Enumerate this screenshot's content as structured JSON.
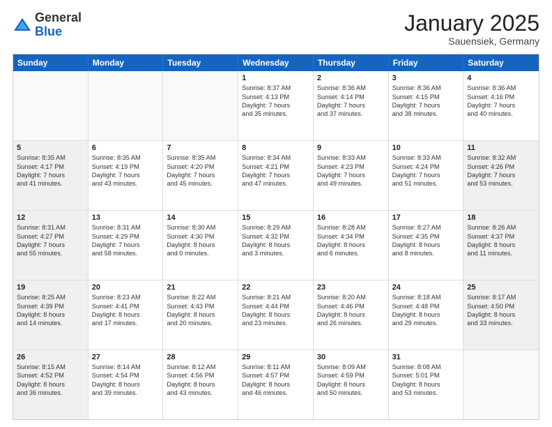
{
  "logo": {
    "general": "General",
    "blue": "Blue"
  },
  "header": {
    "month": "January 2025",
    "location": "Sauensiek, Germany"
  },
  "weekdays": [
    "Sunday",
    "Monday",
    "Tuesday",
    "Wednesday",
    "Thursday",
    "Friday",
    "Saturday"
  ],
  "rows": [
    [
      {
        "day": "",
        "sunrise": "",
        "sunset": "",
        "daylight": "",
        "shaded": true
      },
      {
        "day": "",
        "sunrise": "",
        "sunset": "",
        "daylight": "",
        "shaded": true
      },
      {
        "day": "",
        "sunrise": "",
        "sunset": "",
        "daylight": "",
        "shaded": true
      },
      {
        "day": "1",
        "sunrise": "Sunrise: 8:37 AM",
        "sunset": "Sunset: 4:13 PM",
        "daylight": "Daylight: 7 hours and 35 minutes.",
        "shaded": false
      },
      {
        "day": "2",
        "sunrise": "Sunrise: 8:36 AM",
        "sunset": "Sunset: 4:14 PM",
        "daylight": "Daylight: 7 hours and 37 minutes.",
        "shaded": false
      },
      {
        "day": "3",
        "sunrise": "Sunrise: 8:36 AM",
        "sunset": "Sunset: 4:15 PM",
        "daylight": "Daylight: 7 hours and 38 minutes.",
        "shaded": false
      },
      {
        "day": "4",
        "sunrise": "Sunrise: 8:36 AM",
        "sunset": "Sunset: 4:16 PM",
        "daylight": "Daylight: 7 hours and 40 minutes.",
        "shaded": false
      }
    ],
    [
      {
        "day": "5",
        "sunrise": "Sunrise: 8:35 AM",
        "sunset": "Sunset: 4:17 PM",
        "daylight": "Daylight: 7 hours and 41 minutes.",
        "shaded": true
      },
      {
        "day": "6",
        "sunrise": "Sunrise: 8:35 AM",
        "sunset": "Sunset: 4:19 PM",
        "daylight": "Daylight: 7 hours and 43 minutes.",
        "shaded": false
      },
      {
        "day": "7",
        "sunrise": "Sunrise: 8:35 AM",
        "sunset": "Sunset: 4:20 PM",
        "daylight": "Daylight: 7 hours and 45 minutes.",
        "shaded": false
      },
      {
        "day": "8",
        "sunrise": "Sunrise: 8:34 AM",
        "sunset": "Sunset: 4:21 PM",
        "daylight": "Daylight: 7 hours and 47 minutes.",
        "shaded": false
      },
      {
        "day": "9",
        "sunrise": "Sunrise: 8:33 AM",
        "sunset": "Sunset: 4:23 PM",
        "daylight": "Daylight: 7 hours and 49 minutes.",
        "shaded": false
      },
      {
        "day": "10",
        "sunrise": "Sunrise: 8:33 AM",
        "sunset": "Sunset: 4:24 PM",
        "daylight": "Daylight: 7 hours and 51 minutes.",
        "shaded": false
      },
      {
        "day": "11",
        "sunrise": "Sunrise: 8:32 AM",
        "sunset": "Sunset: 4:26 PM",
        "daylight": "Daylight: 7 hours and 53 minutes.",
        "shaded": true
      }
    ],
    [
      {
        "day": "12",
        "sunrise": "Sunrise: 8:31 AM",
        "sunset": "Sunset: 4:27 PM",
        "daylight": "Daylight: 7 hours and 55 minutes.",
        "shaded": true
      },
      {
        "day": "13",
        "sunrise": "Sunrise: 8:31 AM",
        "sunset": "Sunset: 4:29 PM",
        "daylight": "Daylight: 7 hours and 58 minutes.",
        "shaded": false
      },
      {
        "day": "14",
        "sunrise": "Sunrise: 8:30 AM",
        "sunset": "Sunset: 4:30 PM",
        "daylight": "Daylight: 8 hours and 0 minutes.",
        "shaded": false
      },
      {
        "day": "15",
        "sunrise": "Sunrise: 8:29 AM",
        "sunset": "Sunset: 4:32 PM",
        "daylight": "Daylight: 8 hours and 3 minutes.",
        "shaded": false
      },
      {
        "day": "16",
        "sunrise": "Sunrise: 8:28 AM",
        "sunset": "Sunset: 4:34 PM",
        "daylight": "Daylight: 8 hours and 6 minutes.",
        "shaded": false
      },
      {
        "day": "17",
        "sunrise": "Sunrise: 8:27 AM",
        "sunset": "Sunset: 4:35 PM",
        "daylight": "Daylight: 8 hours and 8 minutes.",
        "shaded": false
      },
      {
        "day": "18",
        "sunrise": "Sunrise: 8:26 AM",
        "sunset": "Sunset: 4:37 PM",
        "daylight": "Daylight: 8 hours and 11 minutes.",
        "shaded": true
      }
    ],
    [
      {
        "day": "19",
        "sunrise": "Sunrise: 8:25 AM",
        "sunset": "Sunset: 4:39 PM",
        "daylight": "Daylight: 8 hours and 14 minutes.",
        "shaded": true
      },
      {
        "day": "20",
        "sunrise": "Sunrise: 8:23 AM",
        "sunset": "Sunset: 4:41 PM",
        "daylight": "Daylight: 8 hours and 17 minutes.",
        "shaded": false
      },
      {
        "day": "21",
        "sunrise": "Sunrise: 8:22 AM",
        "sunset": "Sunset: 4:43 PM",
        "daylight": "Daylight: 8 hours and 20 minutes.",
        "shaded": false
      },
      {
        "day": "22",
        "sunrise": "Sunrise: 8:21 AM",
        "sunset": "Sunset: 4:44 PM",
        "daylight": "Daylight: 8 hours and 23 minutes.",
        "shaded": false
      },
      {
        "day": "23",
        "sunrise": "Sunrise: 8:20 AM",
        "sunset": "Sunset: 4:46 PM",
        "daylight": "Daylight: 8 hours and 26 minutes.",
        "shaded": false
      },
      {
        "day": "24",
        "sunrise": "Sunrise: 8:18 AM",
        "sunset": "Sunset: 4:48 PM",
        "daylight": "Daylight: 8 hours and 29 minutes.",
        "shaded": false
      },
      {
        "day": "25",
        "sunrise": "Sunrise: 8:17 AM",
        "sunset": "Sunset: 4:50 PM",
        "daylight": "Daylight: 8 hours and 33 minutes.",
        "shaded": true
      }
    ],
    [
      {
        "day": "26",
        "sunrise": "Sunrise: 8:15 AM",
        "sunset": "Sunset: 4:52 PM",
        "daylight": "Daylight: 8 hours and 36 minutes.",
        "shaded": true
      },
      {
        "day": "27",
        "sunrise": "Sunrise: 8:14 AM",
        "sunset": "Sunset: 4:54 PM",
        "daylight": "Daylight: 8 hours and 39 minutes.",
        "shaded": false
      },
      {
        "day": "28",
        "sunrise": "Sunrise: 8:12 AM",
        "sunset": "Sunset: 4:56 PM",
        "daylight": "Daylight: 8 hours and 43 minutes.",
        "shaded": false
      },
      {
        "day": "29",
        "sunrise": "Sunrise: 8:11 AM",
        "sunset": "Sunset: 4:57 PM",
        "daylight": "Daylight: 8 hours and 46 minutes.",
        "shaded": false
      },
      {
        "day": "30",
        "sunrise": "Sunrise: 8:09 AM",
        "sunset": "Sunset: 4:59 PM",
        "daylight": "Daylight: 8 hours and 50 minutes.",
        "shaded": false
      },
      {
        "day": "31",
        "sunrise": "Sunrise: 8:08 AM",
        "sunset": "Sunset: 5:01 PM",
        "daylight": "Daylight: 8 hours and 53 minutes.",
        "shaded": false
      },
      {
        "day": "",
        "sunrise": "",
        "sunset": "",
        "daylight": "",
        "shaded": true
      }
    ]
  ]
}
